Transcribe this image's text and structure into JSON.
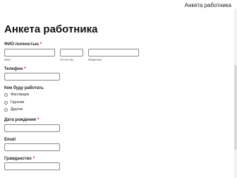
{
  "window": {
    "title": "Анкета работника"
  },
  "form": {
    "title": "Анкета работника",
    "required_mark": "*",
    "full_name": {
      "label": "ФИО полностью",
      "parts": [
        "Имя",
        "Отчество",
        "Фамилия"
      ]
    },
    "phone": {
      "label": "Телефон"
    },
    "role": {
      "label": "Кем буду работать",
      "options": [
        "Фасовщик",
        "Грузчик",
        "Другое"
      ]
    },
    "birth_date": {
      "label": "Дата рождения"
    },
    "email": {
      "label": "Email"
    },
    "citizenship": {
      "label": "Гражданство"
    }
  }
}
